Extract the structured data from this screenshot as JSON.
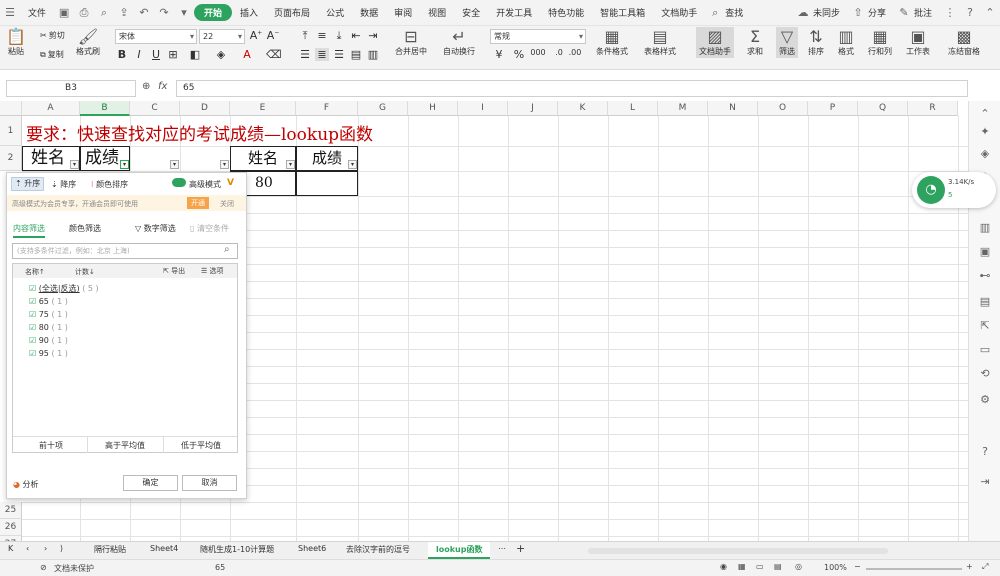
{
  "menu": {
    "file": "文件",
    "tabs": [
      "开始",
      "插入",
      "页面布局",
      "公式",
      "数据",
      "审阅",
      "视图",
      "安全",
      "开发工具",
      "特色功能",
      "智能工具箱",
      "文档助手",
      "查找"
    ],
    "sync": "未同步",
    "share": "分享",
    "comment": "批注"
  },
  "ribbon": {
    "paste": "粘贴",
    "cut": "剪切",
    "copy": "复制",
    "format_painter": "格式刷",
    "font_name": "宋体",
    "font_size": "22",
    "merge_center": "合并居中",
    "wrap_text": "自动换行",
    "number_format": "常规",
    "cond_format": "条件格式",
    "table_style": "表格样式",
    "doc_helper": "文档助手",
    "sum": "求和",
    "filter": "筛选",
    "sort": "排序",
    "format": "格式",
    "row_col": "行和列",
    "worksheet": "工作表",
    "freeze": "冻结窗格",
    "percent_sign": "%",
    "thousand_sign": "000"
  },
  "formula_bar": {
    "cell_ref": "B3",
    "fx_label": "fx",
    "value": "65"
  },
  "columns": [
    "A",
    "B",
    "C",
    "D",
    "E",
    "F",
    "G",
    "H",
    "I",
    "J",
    "K",
    "L",
    "M",
    "N",
    "O",
    "P",
    "Q",
    "R"
  ],
  "rows": [
    "1",
    "2",
    "25",
    "26",
    "27",
    "28"
  ],
  "cells": {
    "title": "要求：快速查找对应的考试成绩—lookup函数",
    "a2": "姓名",
    "b2": "成绩",
    "e2": "姓名",
    "f2": "成绩",
    "e3": "80"
  },
  "filter_panel": {
    "sort_asc": "升序",
    "sort_desc": "降序",
    "sort_color": "颜色排序",
    "advanced_mode": "高级模式",
    "vip_tip": "高级模式为会员专享，开通会员即可使用",
    "open_btn": "开通",
    "close_btn": "关闭",
    "tab_content": "内容筛选",
    "tab_color": "颜色筛选",
    "number_filter": "数字筛选",
    "clear_condition": "清空条件",
    "search_placeholder": "(支持多条件过滤，例如：北京 上海)",
    "col_name": "名称↑",
    "col_count": "计数↓",
    "export": "导出",
    "options": "选项",
    "items": [
      {
        "label": "(全选|反选)",
        "count": "( 5 )"
      },
      {
        "label": "65",
        "count": "( 1 )"
      },
      {
        "label": "75",
        "count": "( 1 )"
      },
      {
        "label": "80",
        "count": "( 1 )"
      },
      {
        "label": "90",
        "count": "( 1 )"
      },
      {
        "label": "95",
        "count": "( 1 )"
      }
    ],
    "top10": "前十项",
    "above_avg": "高于平均值",
    "below_avg": "低于平均值",
    "analyze": "分析",
    "ok": "确定",
    "cancel": "取消"
  },
  "network": {
    "speed": "3.14K/s",
    "count": "5"
  },
  "sheet_tabs": [
    "隔行粘贴",
    "Sheet4",
    "随机生成1-10计算题",
    "Sheet6",
    "去除汉字前的逗号",
    "lookup函数"
  ],
  "active_sheet": "lookup函数",
  "status": {
    "doc_state": "文档未保护",
    "value": "65",
    "zoom": "100%"
  },
  "colors": {
    "accent": "#2ea35f",
    "title_red": "#c00000"
  }
}
